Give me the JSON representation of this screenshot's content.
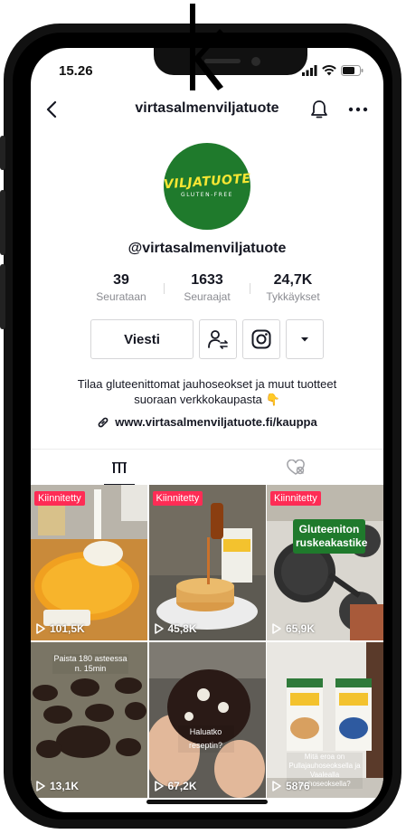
{
  "status_bar": {
    "time": "15.26"
  },
  "header": {
    "title": "virtasalmenviljatuote"
  },
  "avatar": {
    "brand_text": "VILJATUOTE",
    "sub_text": "GLUTEN-FREE"
  },
  "profile": {
    "handle": "@virtasalmenviljatuote"
  },
  "stats": [
    {
      "value": "39",
      "label": "Seurataan"
    },
    {
      "value": "1633",
      "label": "Seuraajat"
    },
    {
      "value": "24,7K",
      "label": "Tykkäykset"
    }
  ],
  "actions": {
    "message_label": "Viesti"
  },
  "bio": {
    "line1": "Tilaa gluteenittomat jauhoseokset ja muut tuotteet",
    "line2": "suoraan verkkokaupasta 👇",
    "link": "www.virtasalmenviljatuote.fi/kauppa"
  },
  "videos": [
    {
      "pinned": "Kiinnitetty",
      "views": "101,5K",
      "overlay": ""
    },
    {
      "pinned": "Kiinnitetty",
      "views": "45,8K",
      "overlay": ""
    },
    {
      "pinned": "Kiinnitetty",
      "views": "65,9K",
      "overlay": "Gluteeniton ruskeakastike"
    },
    {
      "pinned": "",
      "views": "13,1K",
      "overlay": "Paista 180 asteessa n. 15min"
    },
    {
      "pinned": "",
      "views": "67,2K",
      "overlay": "Haluatko reseptin?"
    },
    {
      "pinned": "",
      "views": "5876",
      "overlay": "Mitä eroa on Pullajauhoseoksella ja Vaalealla jauhoseoksella?"
    }
  ],
  "colors": {
    "accent": "#fe2c55",
    "avatar_bg": "#1f7a2c",
    "avatar_text": "#f7e733"
  }
}
